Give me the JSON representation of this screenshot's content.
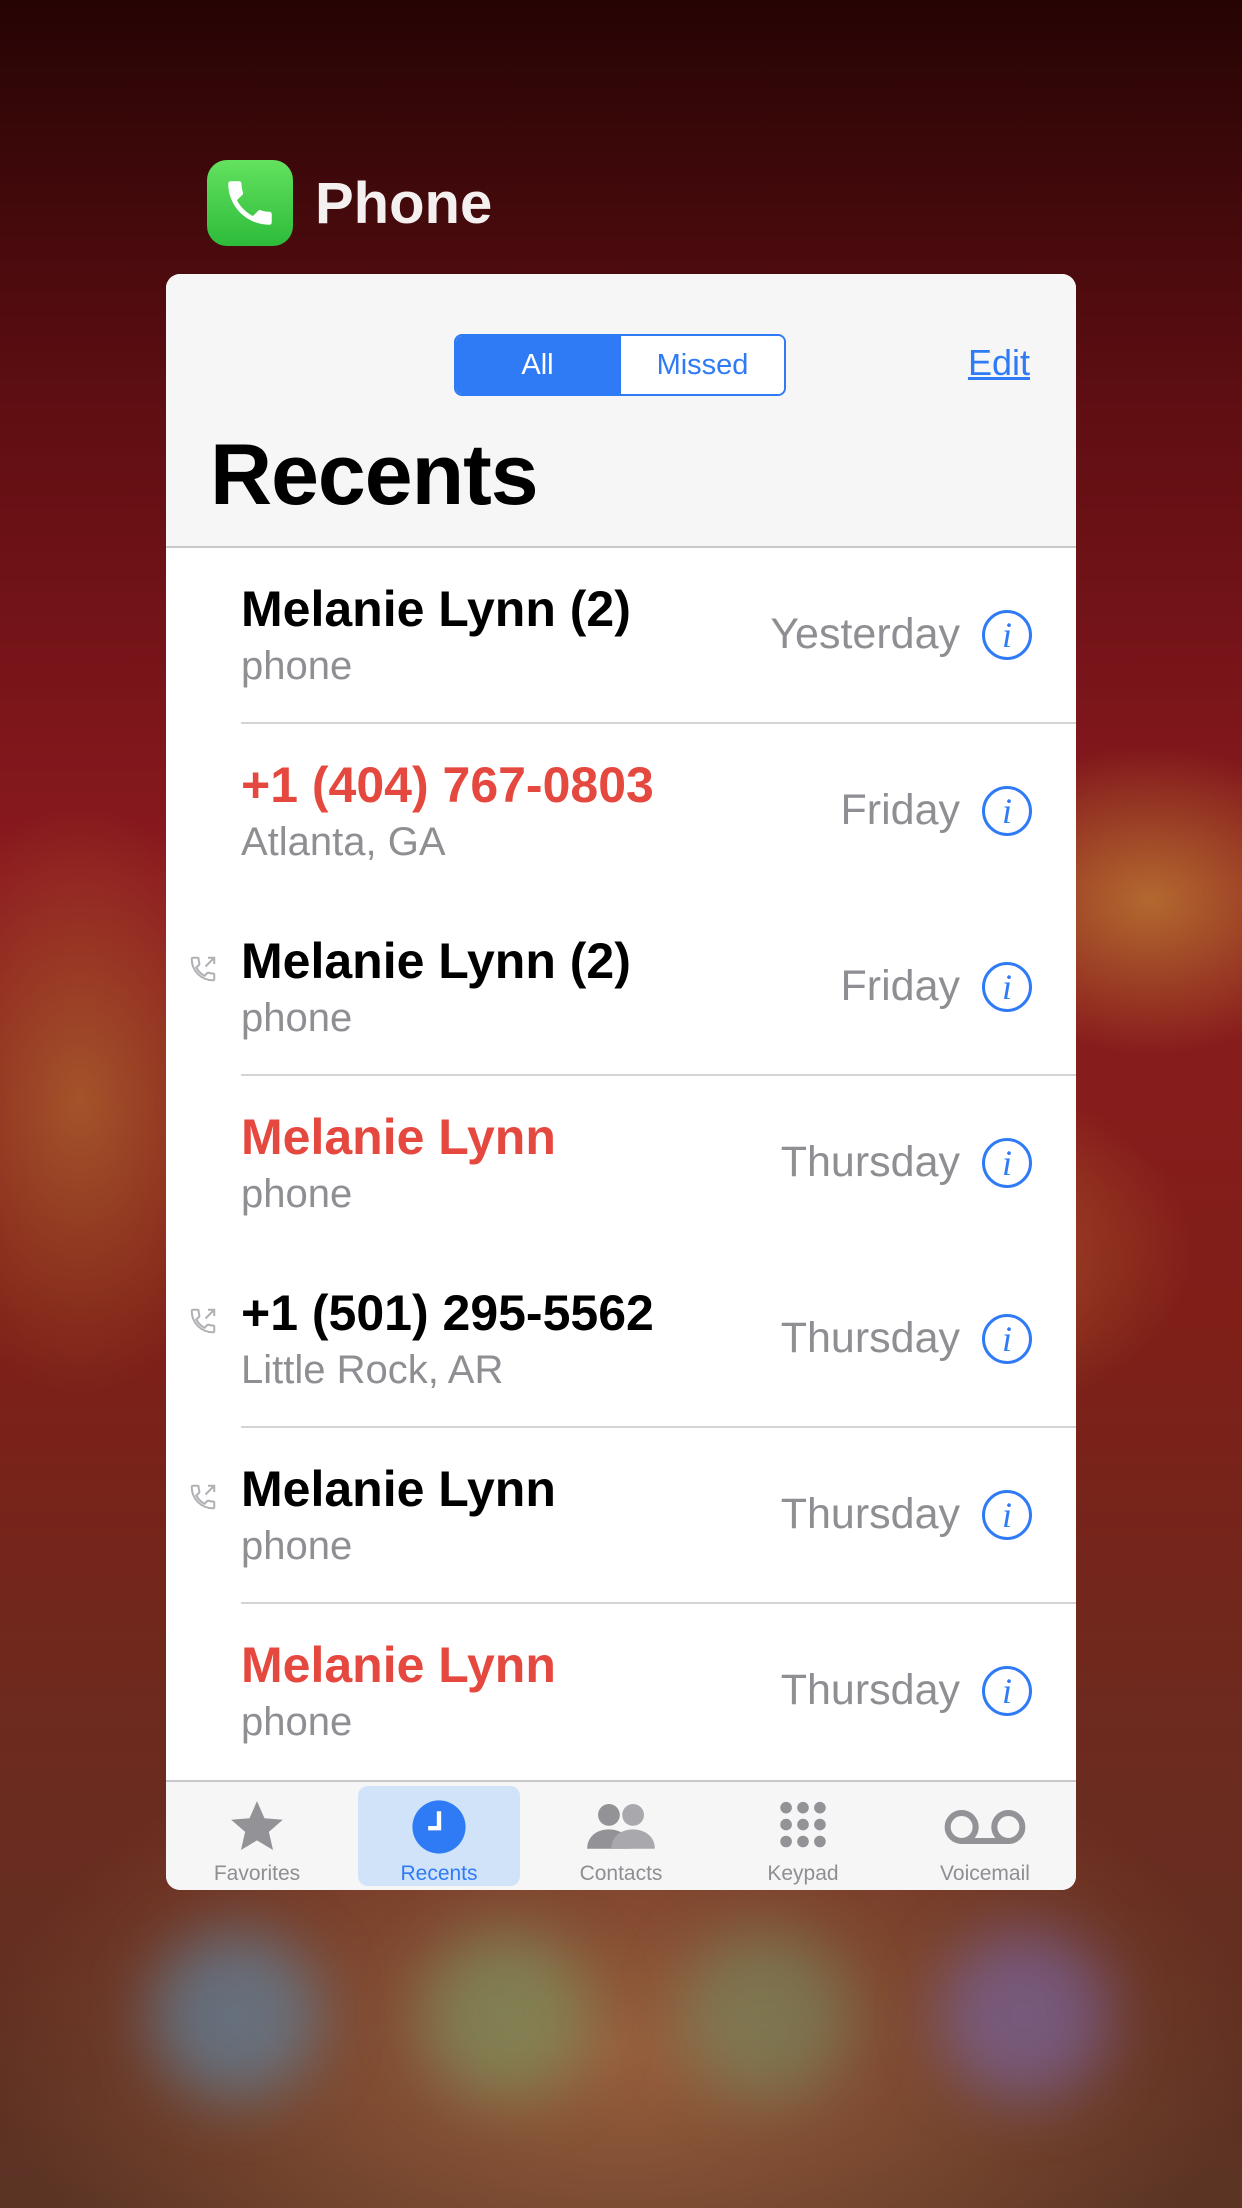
{
  "app": {
    "name": "Phone"
  },
  "segments": {
    "all": "All",
    "missed": "Missed"
  },
  "edit_label": "Edit",
  "title": "Recents",
  "calls": [
    {
      "name": "Melanie Lynn (2)",
      "sub": "phone",
      "when": "Yesterday",
      "missed": false,
      "outgoing": false
    },
    {
      "name": "+1 (404) 767-0803",
      "sub": "Atlanta, GA",
      "when": "Friday",
      "missed": true,
      "outgoing": false
    },
    {
      "name": "Melanie Lynn (2)",
      "sub": "phone",
      "when": "Friday",
      "missed": false,
      "outgoing": true
    },
    {
      "name": "Melanie Lynn",
      "sub": "phone",
      "when": "Thursday",
      "missed": true,
      "outgoing": false
    },
    {
      "name": "+1 (501) 295-5562",
      "sub": "Little Rock, AR",
      "when": "Thursday",
      "missed": false,
      "outgoing": true
    },
    {
      "name": "Melanie Lynn",
      "sub": "phone",
      "when": "Thursday",
      "missed": false,
      "outgoing": true
    },
    {
      "name": "Melanie Lynn",
      "sub": "phone",
      "when": "Thursday",
      "missed": true,
      "outgoing": false
    }
  ],
  "tabs": [
    {
      "label": "Favorites",
      "icon": "star-icon",
      "selected": false
    },
    {
      "label": "Recents",
      "icon": "clock-icon",
      "selected": true
    },
    {
      "label": "Contacts",
      "icon": "contacts-icon",
      "selected": false
    },
    {
      "label": "Keypad",
      "icon": "keypad-icon",
      "selected": false
    },
    {
      "label": "Voicemail",
      "icon": "voicemail-icon",
      "selected": false
    }
  ],
  "colors": {
    "accent": "#2f7bf6",
    "missed": "#e5483f",
    "secondary": "#8e8e93"
  }
}
